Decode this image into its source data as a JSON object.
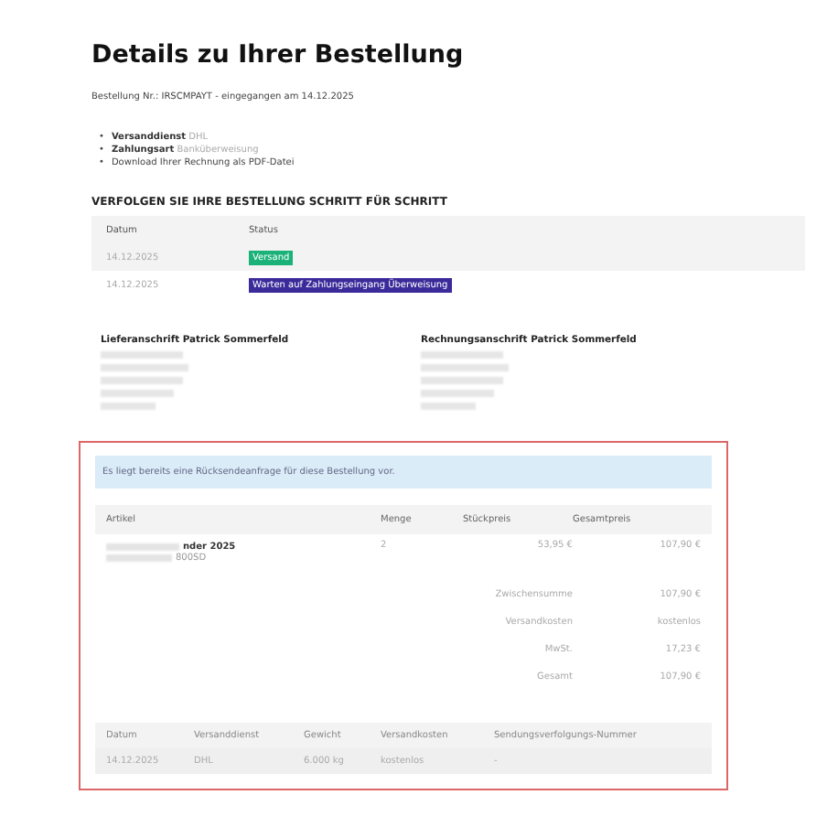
{
  "title": "Details zu Ihrer Bestellung",
  "order_line": "Bestellung Nr.: IRSCMPAYT - eingegangen am 14.12.2025",
  "info": [
    {
      "bullet": "•",
      "label": "Versanddienst",
      "value": "DHL"
    },
    {
      "bullet": "•",
      "label": "Zahlungsart",
      "value": "Banküberweisung"
    },
    {
      "bullet": "•",
      "value": "Download Ihrer Rechnung als PDF-Datei"
    }
  ],
  "tracking": {
    "heading": "VERFOLGEN SIE IHRE BESTELLUNG SCHRITT FÜR SCHRITT",
    "columns": [
      "Datum",
      "Status"
    ],
    "rows": [
      {
        "date": "14.12.2025",
        "status": "Versand",
        "color": "#1bb27a"
      },
      {
        "date": "14.12.2025",
        "status": "Warten auf Zahlungseingang Überweisung",
        "color": "#3a2a9a"
      }
    ]
  },
  "addresses": [
    {
      "heading": "Lieferanschrift Patrick Sommerfeld"
    },
    {
      "heading": "Rechnungsanschrift Patrick Sommerfeld"
    }
  ],
  "notice": "Es liegt bereits eine Rücksendeanfrage für diese Bestellung vor.",
  "items": {
    "columns": [
      "Artikel",
      "Menge",
      "Stückpreis",
      "Gesamtpreis"
    ],
    "rows": [
      {
        "name": "nder 2025",
        "sku": "800SD",
        "qty": "2",
        "unit": "53,95 €",
        "total": "107,90 €"
      }
    ]
  },
  "totals": [
    {
      "label": "Zwischensumme",
      "value": "107,90 €"
    },
    {
      "label": "Versandkosten",
      "value": "kostenlos"
    },
    {
      "label": "MwSt.",
      "value": "17,23 €"
    },
    {
      "label": "Gesamt",
      "value": "107,90 €"
    }
  ],
  "shipment": {
    "columns": [
      "Datum",
      "Versanddienst",
      "Gewicht",
      "Versandkosten",
      "Sendungsverfolgungs-Nummer"
    ],
    "rows": [
      [
        "14.12.2025",
        "DHL",
        "6.000 kg",
        "kostenlos",
        "-"
      ]
    ]
  }
}
